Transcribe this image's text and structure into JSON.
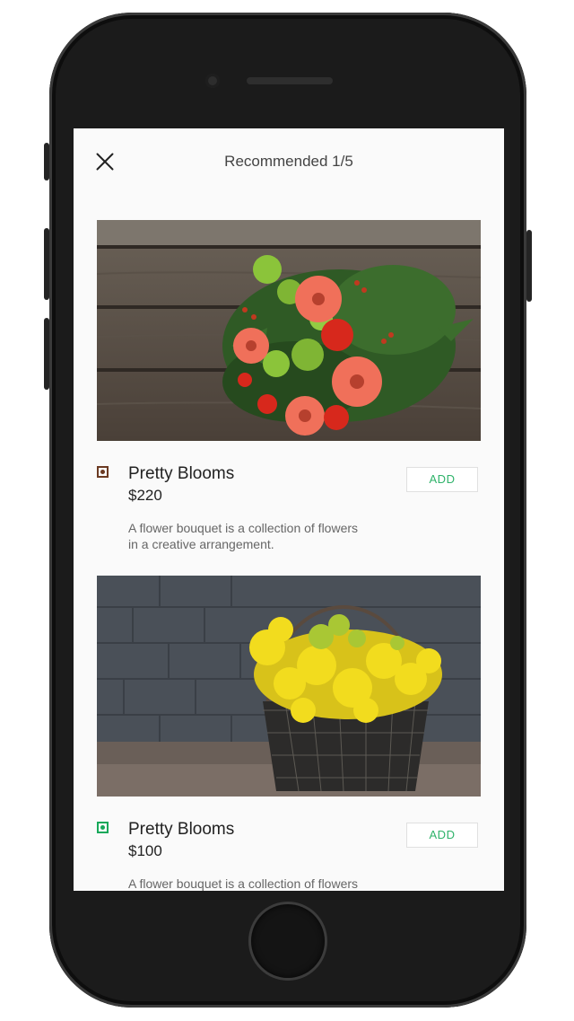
{
  "header": {
    "title": "Recommended 1/5"
  },
  "items": [
    {
      "name": "Pretty Blooms",
      "price": "$220",
      "description": "A flower bouquet is a collection of flowers in a creative arrangement.",
      "add_label": "ADD",
      "type_indicator_color": "#6b3a22",
      "image_subject": "bouquet of orange gerberas and red roses on wooden planks"
    },
    {
      "name": "Pretty Blooms",
      "price": "$100",
      "description": "A flower bouquet is a collection of flowers in a creative arrangement.",
      "add_label": "ADD",
      "type_indicator_color": "#17a85a",
      "image_subject": "yellow flowers in a wire basket against a brick wall"
    }
  ],
  "colors": {
    "accent_green": "#2fb36a",
    "screen_background": "#fafafa"
  }
}
